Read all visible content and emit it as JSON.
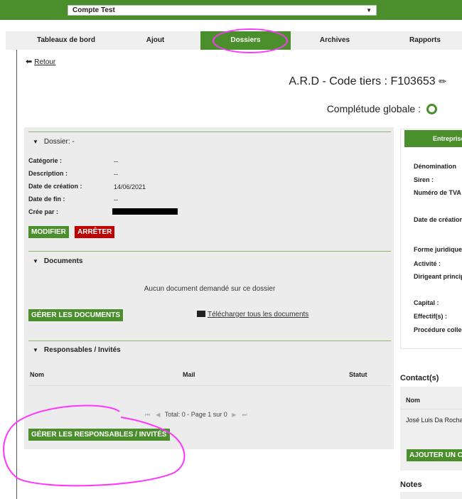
{
  "account": {
    "selected": "Compte Test",
    "chevron_icon": "chevron-down-icon"
  },
  "nav": [
    {
      "label": "Tableaux de bord"
    },
    {
      "label": "Ajout"
    },
    {
      "label": "Dossiers",
      "active": true
    },
    {
      "label": "Archives"
    },
    {
      "label": "Rapports"
    }
  ],
  "back_label": "Retour",
  "page": {
    "title": "A.R.D - Code tiers : F103653",
    "completude_label": "Complétude globale :"
  },
  "dossier": {
    "section_title": "Dossier: -",
    "fields": [
      {
        "label": "Catégorie :",
        "value": "--"
      },
      {
        "label": "Description :",
        "value": "--"
      },
      {
        "label": "Date de création :",
        "value": "14/06/2021"
      },
      {
        "label": "Date de fin :",
        "value": "--"
      },
      {
        "label": "Crée par :",
        "value": ""
      }
    ],
    "modify_button": "MODIFIER",
    "stop_button": "ARRÊTER"
  },
  "documents": {
    "section_title": "Documents",
    "empty_message": "Aucun document demandé sur ce dossier",
    "manage_button": "GÉRER LES DOCUMENTS",
    "download_all_link": "Télécharger tous les documents"
  },
  "responsables": {
    "section_title": "Responsables / Invités",
    "columns": [
      "Nom",
      "Mail",
      "Statut"
    ],
    "pager_text": "Total: 0 - Page 1 sur 0",
    "manage_button": "GÉRER LES RESPONSABLES / INVITÉS"
  },
  "entreprise": {
    "header": "Entreprise",
    "labels": [
      "Dénomination",
      "Siren :",
      "Numéro de TVA",
      "Date de création",
      "Forme juridique",
      "Activité :",
      "Dirigeant principal",
      "Capital :",
      "Effectif(s) :",
      "Procédure collective"
    ]
  },
  "contacts": {
    "title": "Contact(s)",
    "column": "Nom",
    "rows": [
      "José Luis Da Rocha"
    ],
    "add_button": "AJOUTER UN CONTACT"
  },
  "notes": {
    "title": "Notes"
  },
  "colors": {
    "brand_green": "#4a8f2c",
    "stop_red": "#c00000",
    "annotation_magenta": "#ff35ff"
  }
}
